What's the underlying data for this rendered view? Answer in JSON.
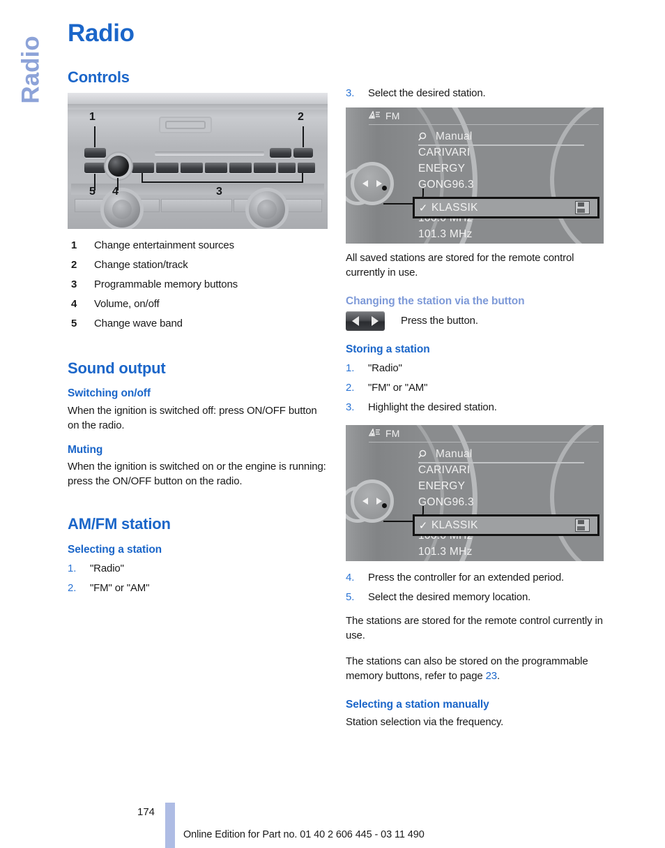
{
  "side_tab": "Radio",
  "title": "Radio",
  "left": {
    "controls_heading": "Controls",
    "legend": [
      {
        "num": "1",
        "text": "Change entertainment sources"
      },
      {
        "num": "2",
        "text": "Change station/track"
      },
      {
        "num": "3",
        "text": "Programmable memory buttons"
      },
      {
        "num": "4",
        "text": "Volume, on/off"
      },
      {
        "num": "5",
        "text": "Change wave band"
      }
    ],
    "sound_output_heading": "Sound output",
    "switching_heading": "Switching on/off",
    "switching_body": "When the ignition is switched off: press ON/OFF button on the radio.",
    "muting_heading": "Muting",
    "muting_body": "When the ignition is switched on or the engine is running: press the ON/OFF button on the radio.",
    "amfm_heading": "AM/FM station",
    "selecting_heading": "Selecting a station",
    "selecting_steps": [
      {
        "num": "1.",
        "text": "\"Radio\""
      },
      {
        "num": "2.",
        "text": "\"FM\" or \"AM\""
      }
    ]
  },
  "right": {
    "step3_top": {
      "num": "3.",
      "text": "Select the desired station."
    },
    "saved_note": "All saved stations are stored for the remote control currently in use.",
    "changing_heading": "Changing the station via the button",
    "press_button_caption": "Press the button.",
    "storing_heading": "Storing a station",
    "storing_steps_top": [
      {
        "num": "1.",
        "text": "\"Radio\""
      },
      {
        "num": "2.",
        "text": "\"FM\" or \"AM\""
      },
      {
        "num": "3.",
        "text": "Highlight the desired station."
      }
    ],
    "storing_steps_bottom": [
      {
        "num": "4.",
        "text": "Press the controller for an extended period."
      },
      {
        "num": "5.",
        "text": "Select the desired memory location."
      }
    ],
    "stored_note": "The stations are stored for the remote control currently in use.",
    "programmable_note_pre": "The stations can also be stored on the programmable memory buttons, refer to page ",
    "programmable_note_page": "23",
    "programmable_note_post": ".",
    "manual_heading": "Selecting a station manually",
    "manual_body": "Station selection via the frequency."
  },
  "screen": {
    "band_label": "FM",
    "manual_label": "Manual",
    "stations": [
      "CARIVARI",
      "ENERGY",
      "GONG96.3"
    ],
    "highlighted": {
      "check": "✓",
      "name": "KLASSIK"
    },
    "frequencies": [
      "100.0  MHz",
      "101.3  MHz"
    ]
  },
  "faceplate": {
    "callouts": [
      "1",
      "2",
      "3",
      "4",
      "5"
    ]
  },
  "footer": {
    "page_number": "174",
    "note": "Online Edition for Part no. 01 40 2 606 445 - 03 11 490"
  },
  "colors": {
    "heading_blue": "#1b66c9",
    "light_blue": "#7e9ad8",
    "tab_blue": "#8da3d8",
    "footer_bar": "#aebce4"
  }
}
